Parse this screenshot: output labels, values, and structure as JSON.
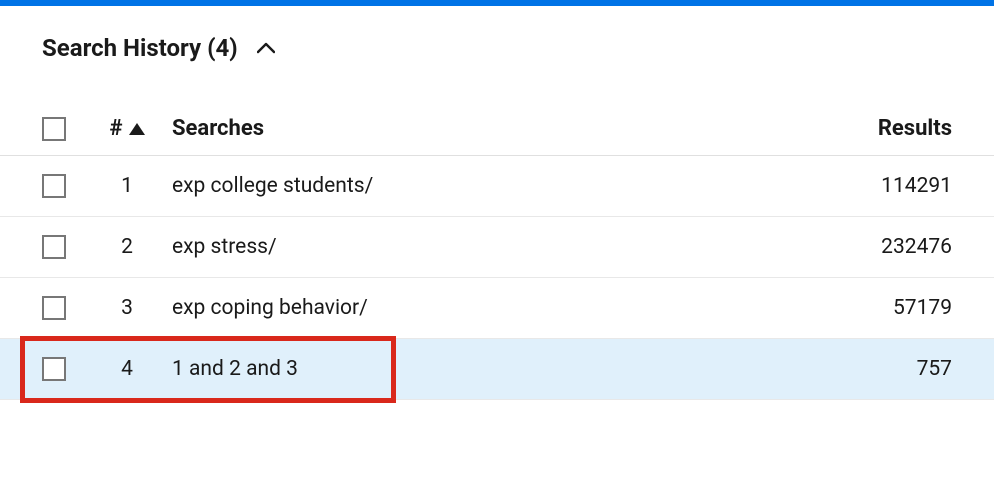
{
  "accent_color": "#0073e6",
  "highlight_color": "#d9281b",
  "row_highlight_color": "#e0f0fb",
  "header": {
    "title": "Search History (4)"
  },
  "table": {
    "columns": {
      "num": "#",
      "searches": "Searches",
      "results": "Results"
    },
    "rows": [
      {
        "num": "1",
        "search": "exp college students/",
        "results": "114291",
        "highlighted": false,
        "boxed": false
      },
      {
        "num": "2",
        "search": "exp stress/",
        "results": "232476",
        "highlighted": false,
        "boxed": false
      },
      {
        "num": "3",
        "search": "exp coping behavior/",
        "results": "57179",
        "highlighted": false,
        "boxed": false
      },
      {
        "num": "4",
        "search": "1 and 2 and 3",
        "results": "757",
        "highlighted": true,
        "boxed": true
      }
    ]
  }
}
